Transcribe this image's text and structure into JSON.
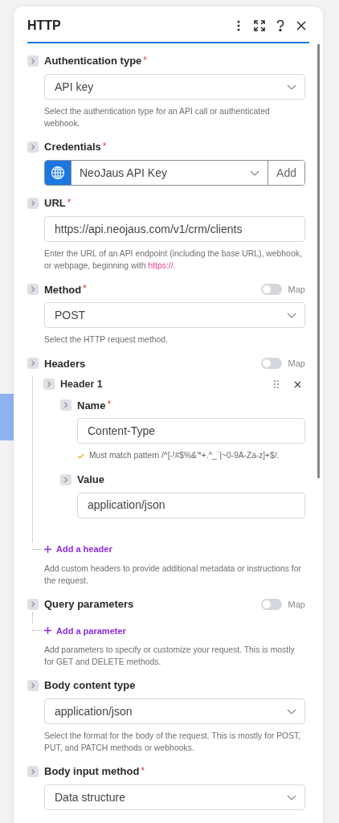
{
  "panel": {
    "title": "HTTP"
  },
  "fields": [
    {
      "kind": "select",
      "label": "Authentication type",
      "required": "*",
      "value": "API key",
      "help": "Select the authentication type for an API call or authenticated webhook."
    },
    {
      "kind": "credential",
      "label": "Credentials",
      "required": "*",
      "value": "NeoJaus API Key",
      "add": "Add"
    },
    {
      "kind": "input",
      "label": "URL",
      "required": "*",
      "value": "https://api.neojaus.com/v1/crm/clients",
      "help": "Enter the URL of an API endpoint (including the base URL), webhook, or webpage, beginning with ",
      "help_code": "https://",
      "help_end": "."
    },
    {
      "kind": "select",
      "label": "Method",
      "required": "*",
      "map": {
        "label": "Map",
        "on": false
      },
      "value": "POST",
      "help": "Select the HTTP request method."
    },
    {
      "kind": "array",
      "label": "Headers",
      "map": {
        "label": "Map",
        "on": false
      },
      "items": [
        {
          "label": "Header 1",
          "fields": [
            {
              "kind": "input",
              "label": "Name",
              "required": "*",
              "value": "Content-Type",
              "check": "Must match pattern /^[-!#$%&'*+.^_`|~0-9A-Za-z]+$/."
            },
            {
              "kind": "input",
              "label": "Value",
              "value": "application/json"
            }
          ]
        }
      ],
      "add": "Add a header",
      "help": "Add custom headers to provide additional metadata or instructions for the request."
    },
    {
      "kind": "array",
      "label": "Query parameters",
      "map": {
        "label": "Map",
        "on": false
      },
      "add": "Add a parameter",
      "help": "Add parameters to specify or customize your request. This is mostly for GET and DELETE methods."
    },
    {
      "kind": "select",
      "label": "Body content type",
      "value": "application/json",
      "help": "Select the format for the body of the request. This is mostly for POST, PUT, and PATCH methods or webhooks."
    },
    {
      "kind": "select",
      "label": "Body input method",
      "required": "*",
      "value": "Data structure"
    }
  ]
}
